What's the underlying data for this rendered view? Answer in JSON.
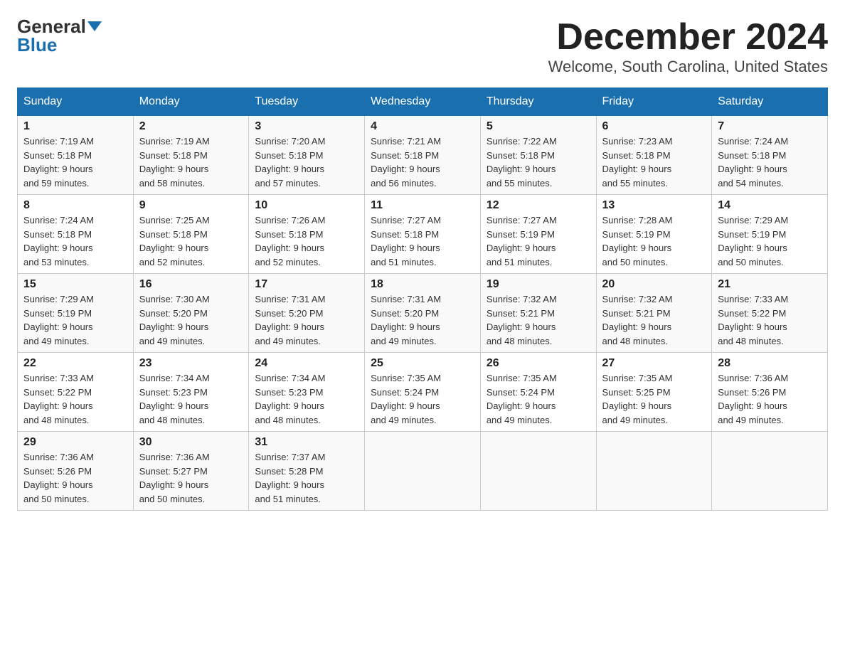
{
  "header": {
    "logo_general": "General",
    "logo_blue": "Blue",
    "month_title": "December 2024",
    "location": "Welcome, South Carolina, United States"
  },
  "days_of_week": [
    "Sunday",
    "Monday",
    "Tuesday",
    "Wednesday",
    "Thursday",
    "Friday",
    "Saturday"
  ],
  "weeks": [
    [
      {
        "day": "1",
        "sunrise": "7:19 AM",
        "sunset": "5:18 PM",
        "daylight": "9 hours and 59 minutes."
      },
      {
        "day": "2",
        "sunrise": "7:19 AM",
        "sunset": "5:18 PM",
        "daylight": "9 hours and 58 minutes."
      },
      {
        "day": "3",
        "sunrise": "7:20 AM",
        "sunset": "5:18 PM",
        "daylight": "9 hours and 57 minutes."
      },
      {
        "day": "4",
        "sunrise": "7:21 AM",
        "sunset": "5:18 PM",
        "daylight": "9 hours and 56 minutes."
      },
      {
        "day": "5",
        "sunrise": "7:22 AM",
        "sunset": "5:18 PM",
        "daylight": "9 hours and 55 minutes."
      },
      {
        "day": "6",
        "sunrise": "7:23 AM",
        "sunset": "5:18 PM",
        "daylight": "9 hours and 55 minutes."
      },
      {
        "day": "7",
        "sunrise": "7:24 AM",
        "sunset": "5:18 PM",
        "daylight": "9 hours and 54 minutes."
      }
    ],
    [
      {
        "day": "8",
        "sunrise": "7:24 AM",
        "sunset": "5:18 PM",
        "daylight": "9 hours and 53 minutes."
      },
      {
        "day": "9",
        "sunrise": "7:25 AM",
        "sunset": "5:18 PM",
        "daylight": "9 hours and 52 minutes."
      },
      {
        "day": "10",
        "sunrise": "7:26 AM",
        "sunset": "5:18 PM",
        "daylight": "9 hours and 52 minutes."
      },
      {
        "day": "11",
        "sunrise": "7:27 AM",
        "sunset": "5:18 PM",
        "daylight": "9 hours and 51 minutes."
      },
      {
        "day": "12",
        "sunrise": "7:27 AM",
        "sunset": "5:19 PM",
        "daylight": "9 hours and 51 minutes."
      },
      {
        "day": "13",
        "sunrise": "7:28 AM",
        "sunset": "5:19 PM",
        "daylight": "9 hours and 50 minutes."
      },
      {
        "day": "14",
        "sunrise": "7:29 AM",
        "sunset": "5:19 PM",
        "daylight": "9 hours and 50 minutes."
      }
    ],
    [
      {
        "day": "15",
        "sunrise": "7:29 AM",
        "sunset": "5:19 PM",
        "daylight": "9 hours and 49 minutes."
      },
      {
        "day": "16",
        "sunrise": "7:30 AM",
        "sunset": "5:20 PM",
        "daylight": "9 hours and 49 minutes."
      },
      {
        "day": "17",
        "sunrise": "7:31 AM",
        "sunset": "5:20 PM",
        "daylight": "9 hours and 49 minutes."
      },
      {
        "day": "18",
        "sunrise": "7:31 AM",
        "sunset": "5:20 PM",
        "daylight": "9 hours and 49 minutes."
      },
      {
        "day": "19",
        "sunrise": "7:32 AM",
        "sunset": "5:21 PM",
        "daylight": "9 hours and 48 minutes."
      },
      {
        "day": "20",
        "sunrise": "7:32 AM",
        "sunset": "5:21 PM",
        "daylight": "9 hours and 48 minutes."
      },
      {
        "day": "21",
        "sunrise": "7:33 AM",
        "sunset": "5:22 PM",
        "daylight": "9 hours and 48 minutes."
      }
    ],
    [
      {
        "day": "22",
        "sunrise": "7:33 AM",
        "sunset": "5:22 PM",
        "daylight": "9 hours and 48 minutes."
      },
      {
        "day": "23",
        "sunrise": "7:34 AM",
        "sunset": "5:23 PM",
        "daylight": "9 hours and 48 minutes."
      },
      {
        "day": "24",
        "sunrise": "7:34 AM",
        "sunset": "5:23 PM",
        "daylight": "9 hours and 48 minutes."
      },
      {
        "day": "25",
        "sunrise": "7:35 AM",
        "sunset": "5:24 PM",
        "daylight": "9 hours and 49 minutes."
      },
      {
        "day": "26",
        "sunrise": "7:35 AM",
        "sunset": "5:24 PM",
        "daylight": "9 hours and 49 minutes."
      },
      {
        "day": "27",
        "sunrise": "7:35 AM",
        "sunset": "5:25 PM",
        "daylight": "9 hours and 49 minutes."
      },
      {
        "day": "28",
        "sunrise": "7:36 AM",
        "sunset": "5:26 PM",
        "daylight": "9 hours and 49 minutes."
      }
    ],
    [
      {
        "day": "29",
        "sunrise": "7:36 AM",
        "sunset": "5:26 PM",
        "daylight": "9 hours and 50 minutes."
      },
      {
        "day": "30",
        "sunrise": "7:36 AM",
        "sunset": "5:27 PM",
        "daylight": "9 hours and 50 minutes."
      },
      {
        "day": "31",
        "sunrise": "7:37 AM",
        "sunset": "5:28 PM",
        "daylight": "9 hours and 51 minutes."
      },
      null,
      null,
      null,
      null
    ]
  ],
  "labels": {
    "sunrise": "Sunrise:",
    "sunset": "Sunset:",
    "daylight": "Daylight:"
  }
}
